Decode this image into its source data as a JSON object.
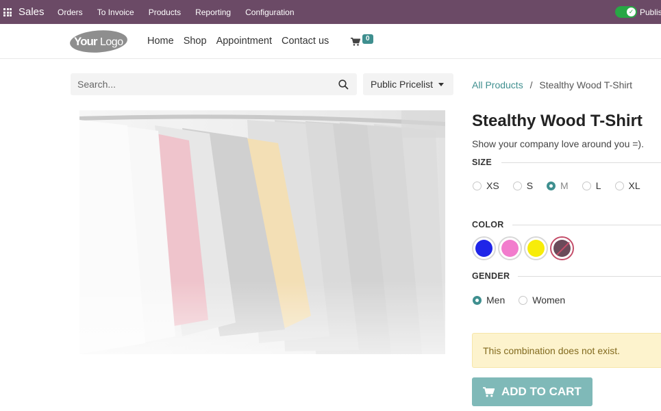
{
  "topbar": {
    "app_name": "Sales",
    "menu": [
      "Orders",
      "To Invoice",
      "Products",
      "Reporting",
      "Configuration"
    ],
    "publish_label": "Publis",
    "published": true
  },
  "navbar": {
    "logo_text": "YourLogo",
    "links": [
      "Home",
      "Shop",
      "Appointment",
      "Contact us"
    ],
    "cart_count": "0"
  },
  "search": {
    "placeholder": "Search...",
    "pricelist": "Public Pricelist"
  },
  "breadcrumb": {
    "parent": "All Products",
    "separator": "/",
    "current": "Stealthy Wood T-Shirt"
  },
  "product": {
    "title": "Stealthy Wood T-Shirt",
    "description": "Show your company love around you =)."
  },
  "attributes": {
    "size": {
      "label": "SIZE",
      "options": [
        "XS",
        "S",
        "M",
        "L",
        "XL"
      ],
      "selected": "M"
    },
    "color": {
      "label": "COLOR",
      "swatches": [
        {
          "name": "blue",
          "hex": "#1f25e8"
        },
        {
          "name": "pink",
          "hex": "#f27ccd"
        },
        {
          "name": "yellow",
          "hex": "#f7ec0a"
        },
        {
          "name": "dark",
          "hex": "#6b4b5a",
          "disabled": true
        }
      ]
    },
    "gender": {
      "label": "GENDER",
      "options": [
        "Men",
        "Women"
      ],
      "selected": "Men"
    }
  },
  "alert": {
    "message": "This combination does not exist."
  },
  "add_to_cart": {
    "label": "ADD TO CART"
  },
  "colors": {
    "admin_bar": "#6b4a66",
    "primary": "#3f8f8f",
    "button_disabled": "#7fb9b8",
    "alert_bg": "#fdf3cd"
  }
}
